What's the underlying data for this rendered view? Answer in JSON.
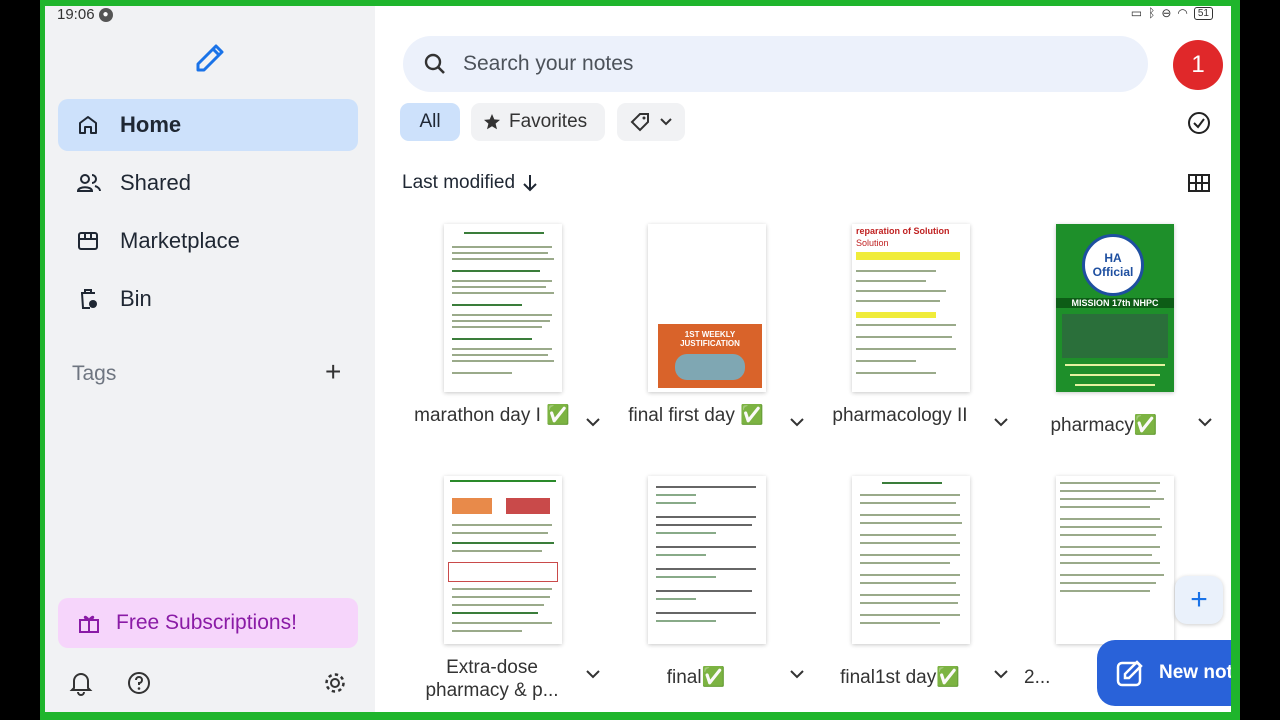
{
  "status": {
    "time": "19:06",
    "battery": "51"
  },
  "sidebar": {
    "items": [
      {
        "label": "Home",
        "icon": "home-icon"
      },
      {
        "label": "Shared",
        "icon": "people-icon"
      },
      {
        "label": "Marketplace",
        "icon": "store-icon"
      },
      {
        "label": "Bin",
        "icon": "bin-icon"
      }
    ],
    "tags_label": "Tags",
    "promo_label": "Free Subscriptions!"
  },
  "search": {
    "placeholder": "Search your notes"
  },
  "notification_count": "1",
  "filters": {
    "all": "All",
    "favorites": "Favorites"
  },
  "sort": {
    "label": "Last modified"
  },
  "notes": [
    {
      "title": "marathon day I ✅"
    },
    {
      "title": "final first day ✅"
    },
    {
      "title": "pharmacology II"
    },
    {
      "title": "pharmacy✅"
    },
    {
      "title": "Extra-dose pharmacy & p..."
    },
    {
      "title": "final✅"
    },
    {
      "title": "final1st day✅"
    },
    {
      "title": "2..."
    }
  ],
  "thumb_text": {
    "solution_header": "reparation of Solution",
    "solution_sub": "Solution",
    "ha_logo": "HA Official",
    "ha_banner": "MISSION 17th NHPC",
    "weekly": "1ST WEEKLY JUSTIFICATION"
  },
  "fab": {
    "new_note": "New note"
  },
  "colors": {
    "accent": "#2962d9",
    "active_nav": "#cde1fb",
    "promo": "#f6d5fb",
    "badge": "#e0282a",
    "frame": "#1fb52c"
  }
}
